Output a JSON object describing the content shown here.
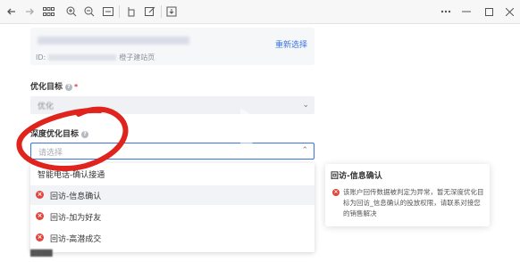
{
  "toolbar": {
    "icons": [
      "back-icon",
      "forward-icon",
      "apps-grid-icon",
      "zoom-in-icon",
      "zoom-out-icon",
      "fit-page-icon",
      "rotate-icon",
      "edit-icon",
      "save-icon",
      "more-icon",
      "minimize-icon",
      "maximize-icon",
      "close-icon"
    ]
  },
  "card": {
    "id_prefix": "ID:",
    "page_type": "橙子建站页",
    "reselect_label": "重新选择"
  },
  "optimize_target": {
    "label": "优化目标",
    "required_mark": "*",
    "value": "优化"
  },
  "deep_target": {
    "label": "深度优化目标",
    "placeholder": "请选择"
  },
  "dropdown": {
    "options": [
      {
        "label": "智能电话-确认接通",
        "status": "ok"
      },
      {
        "label": "回访-信息确认",
        "status": "error"
      },
      {
        "label": "回访-加为好友",
        "status": "error"
      },
      {
        "label": "回访-高潜成交",
        "status": "error"
      }
    ]
  },
  "tooltip": {
    "title": "回访-信息确认",
    "body": "该账户回传数据被判定为异常，暂无深度优化目标为回访_信息确认的投放权限，请联系对接您的销售解决"
  },
  "colors": {
    "accent": "#3a74e3",
    "error": "#e2453c",
    "annotation": "#e0231c"
  }
}
